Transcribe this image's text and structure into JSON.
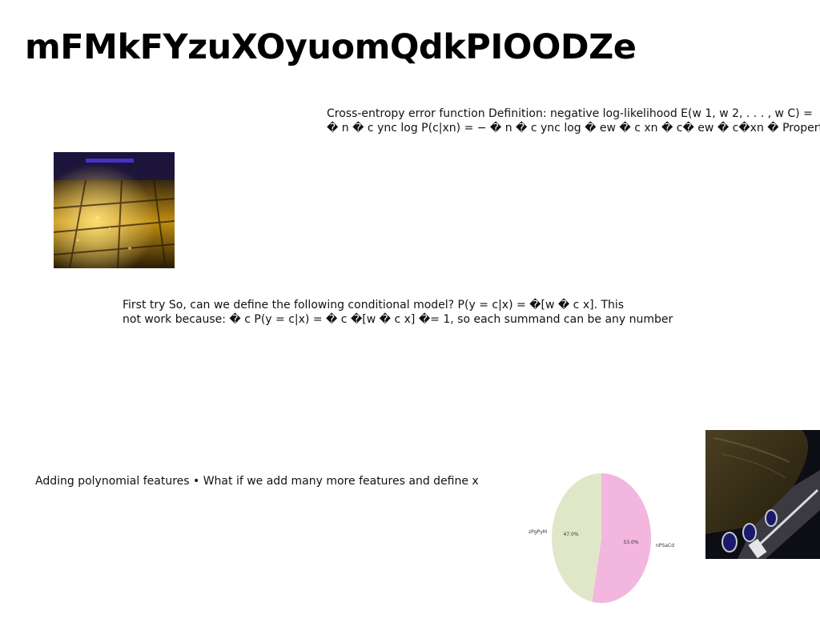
{
  "slide": {
    "title": "mFMkFYzuXOyuomQdkPIOODZe",
    "paragraphs": [
      {
        "lines": [
          "Cross-entropy error function Definition: negative log-likelihood E(w 1, w 2, . . . , w C) =",
          "� n � c ync log P(c|xn) = − � n � c ync log � ew � c xn � c� ew � c�xn � Properties of"
        ]
      },
      {
        "lines": [
          "First try So, can we define the following conditional model? P(y = c|x) = �[w � c x]. This",
          "not work because: � c P(y = c|x) = � c �[w � c x] �= 1, so each summand can be any number"
        ]
      },
      {
        "lines": [
          "Adding polynomial features • What if we add many more features and define x"
        ]
      }
    ],
    "images": [
      {
        "name": "rainy-street-photo",
        "colors": [
          "#1a1205",
          "#d9a414",
          "#2a1a6b"
        ]
      },
      {
        "name": "vintage-car-photo",
        "colors": [
          "#0f0f14",
          "#4a3d22",
          "#2b2f8a"
        ]
      }
    ]
  },
  "chart_data": {
    "type": "pie",
    "title": "",
    "labels": [
      "nPSaCd",
      "zPgPyM"
    ],
    "values": [
      53.0,
      47.0
    ],
    "percent_labels": [
      "53.0%",
      "47.0%"
    ],
    "colors": [
      "#f3b6df",
      "#e0e7c8"
    ],
    "legend": "none"
  }
}
